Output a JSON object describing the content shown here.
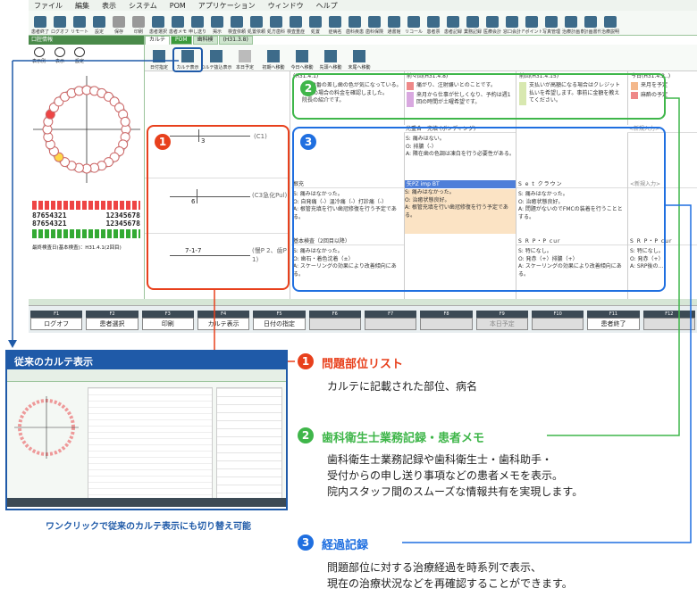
{
  "menubar": {
    "items": [
      "ファイル",
      "編集",
      "表示",
      "システム",
      "POM",
      "アプリケーション",
      "ウィンドウ",
      "ヘルプ"
    ]
  },
  "toolbar": {
    "buttons": [
      "患者終了",
      "ログオフ",
      "リモート",
      "設定",
      "保存",
      "印刷",
      "患者選択",
      "患者メモ",
      "申し送り",
      "掲示",
      "検査依頼",
      "処置依頼",
      "処方歯科",
      "検査重症",
      "処置",
      "症病名",
      "歯科疾患",
      "歯科保険",
      "通書館",
      "リコール",
      "患者票",
      "患者記録",
      "業務記録",
      "医療会計",
      "窓口会計",
      "アポイント",
      "写真管理",
      "治療計画",
      "治療計画書作成",
      "治療説明"
    ]
  },
  "left_pane": {
    "title": "口腔情報",
    "tools": [
      "表示例",
      "表示",
      "設定"
    ],
    "tooth_numbers_upper": "87654321",
    "tooth_numbers_upper2": "12345678",
    "tooth_numbers_lower": "87654321",
    "tooth_numbers_lower2": "12345678",
    "exam_date": "最終検査日(基本検査)：H31.4.1(2回目)"
  },
  "tabs": [
    "カルテ",
    "POM",
    "歯科検",
    "(H31.3.8)"
  ],
  "sub_toolbar": [
    "日付指定",
    "カルテ表示",
    "カルテ抜込表示",
    "本日予定",
    "初期へ移動",
    "今日へ移動",
    "先頭へ移動",
    "末尾へ移動"
  ],
  "problems": [
    {
      "num": "3",
      "label": "(C1)"
    },
    {
      "num": "6",
      "label": "(C3急化Pul)"
    },
    {
      "num": "7-1-7",
      "label": "(慢P 2、歯P 1)"
    }
  ],
  "memo": {
    "cols": [
      "(H31.4.1)",
      "前々回(H31.4.8)",
      "前回(H31.4.15)",
      "今日(H31.4.2..)"
    ],
    "col1": [
      "前回2番の差し歯の色が気になっている。",
      "自費の場合の料金を確認しました。",
      "院長の紹介です。"
    ],
    "col2": [
      "痛がり、注射嫌いとのことです。",
      "来月から仕事が忙しくなり、予約は週1回の時間が土曜希望です。"
    ],
    "col3": [
      "支払いが高額になる場合はクレジット払いを希望します。事前に金額を教えてください。"
    ],
    "col4": [
      "来月を予定",
      "麻酔の予定"
    ]
  },
  "records": {
    "row1_head": [
      "光重合・充填 (ボンディング)",
      "<新規入力>"
    ],
    "row1_col2": [
      "S: 痛みはない。",
      "O: 排膿（-）",
      "A: 隣在歯の色調は凍白を行う必要性がある。"
    ],
    "row2_head": [
      "根充",
      "矢PZ imp BT",
      "S e t クラウン",
      "<新規入力>"
    ],
    "row2_col1": [
      "S: 痛みはなかった。",
      "O: 自発痛（-）温冷痛（-）打診痛（-）",
      "A: 根管充填を行い歯冠修復を行う予定である。"
    ],
    "row2_col2": [
      "S: 痛みはなかった。",
      "O: 治癒状態良好。",
      "A: 根管充填を行い歯冠修復を行う予定である。"
    ],
    "row2_col3": [
      "S: 痛みはなかった。",
      "O: 治癒状態良好。",
      "A: 問題がないのでFMCの装着を行うこととする。"
    ],
    "row3_head": [
      "基本検査（2回目以降）",
      "S R P・P cur",
      "S R P・P cur"
    ],
    "row3_col1": [
      "S: 痛みはなかった。",
      "O: 歯石・着色沈着（±）",
      "A: スケーリングの効果により改善傾向にある。"
    ],
    "row3_col2": [
      "S: 特になし。",
      "O: 発赤（+）排膿（+）",
      "A: スケーリングの効果により改善傾向にある。"
    ],
    "row3_col3": [
      "S: 特になし。",
      "O: 発赤（+）",
      "A: SRP後の…"
    ]
  },
  "fkeys": [
    {
      "n": "F1",
      "l": "ログオフ",
      "dis": false
    },
    {
      "n": "F2",
      "l": "患者選択",
      "dis": false
    },
    {
      "n": "F3",
      "l": "印刷",
      "dis": false
    },
    {
      "n": "F4",
      "l": "カルテ表示",
      "dis": false
    },
    {
      "n": "F5",
      "l": "日付の指定",
      "dis": false
    },
    {
      "n": "F6",
      "l": "",
      "dis": true
    },
    {
      "n": "F7",
      "l": "",
      "dis": true
    },
    {
      "n": "F8",
      "l": "",
      "dis": true
    },
    {
      "n": "F9",
      "l": "本日予定",
      "dis": true
    },
    {
      "n": "F10",
      "l": "",
      "dis": true
    },
    {
      "n": "F11",
      "l": "患者終了",
      "dis": false
    },
    {
      "n": "F12",
      "l": "",
      "dis": true
    }
  ],
  "callouts": {
    "c1": {
      "num": "1",
      "title": "問題部位リスト",
      "text": "カルテに記載された部位、病名"
    },
    "c2": {
      "num": "2",
      "title": "歯科衛生士業務記録・患者メモ",
      "text": [
        "歯科衛生士業務記録や歯科衛生士・歯科助手・",
        "受付からの申し送り事項などの患者メモを表示。",
        "院内スタッフ間のスムーズな情報共有を実現します。"
      ]
    },
    "c3": {
      "num": "3",
      "title": "経過記録",
      "text": [
        "問題部位に対する治療経過を時系列で表示、",
        "現在の治療状況などを再確認することができます。"
      ]
    }
  },
  "thumbnail": {
    "title": "従来のカルテ表示",
    "caption": "ワンクリックで従来のカルテ表示にも切り替え可能"
  },
  "colors": {
    "red": "#e8401c",
    "green": "#3fb64a",
    "blue": "#1f6fe0",
    "navy": "#1f5aa8"
  }
}
